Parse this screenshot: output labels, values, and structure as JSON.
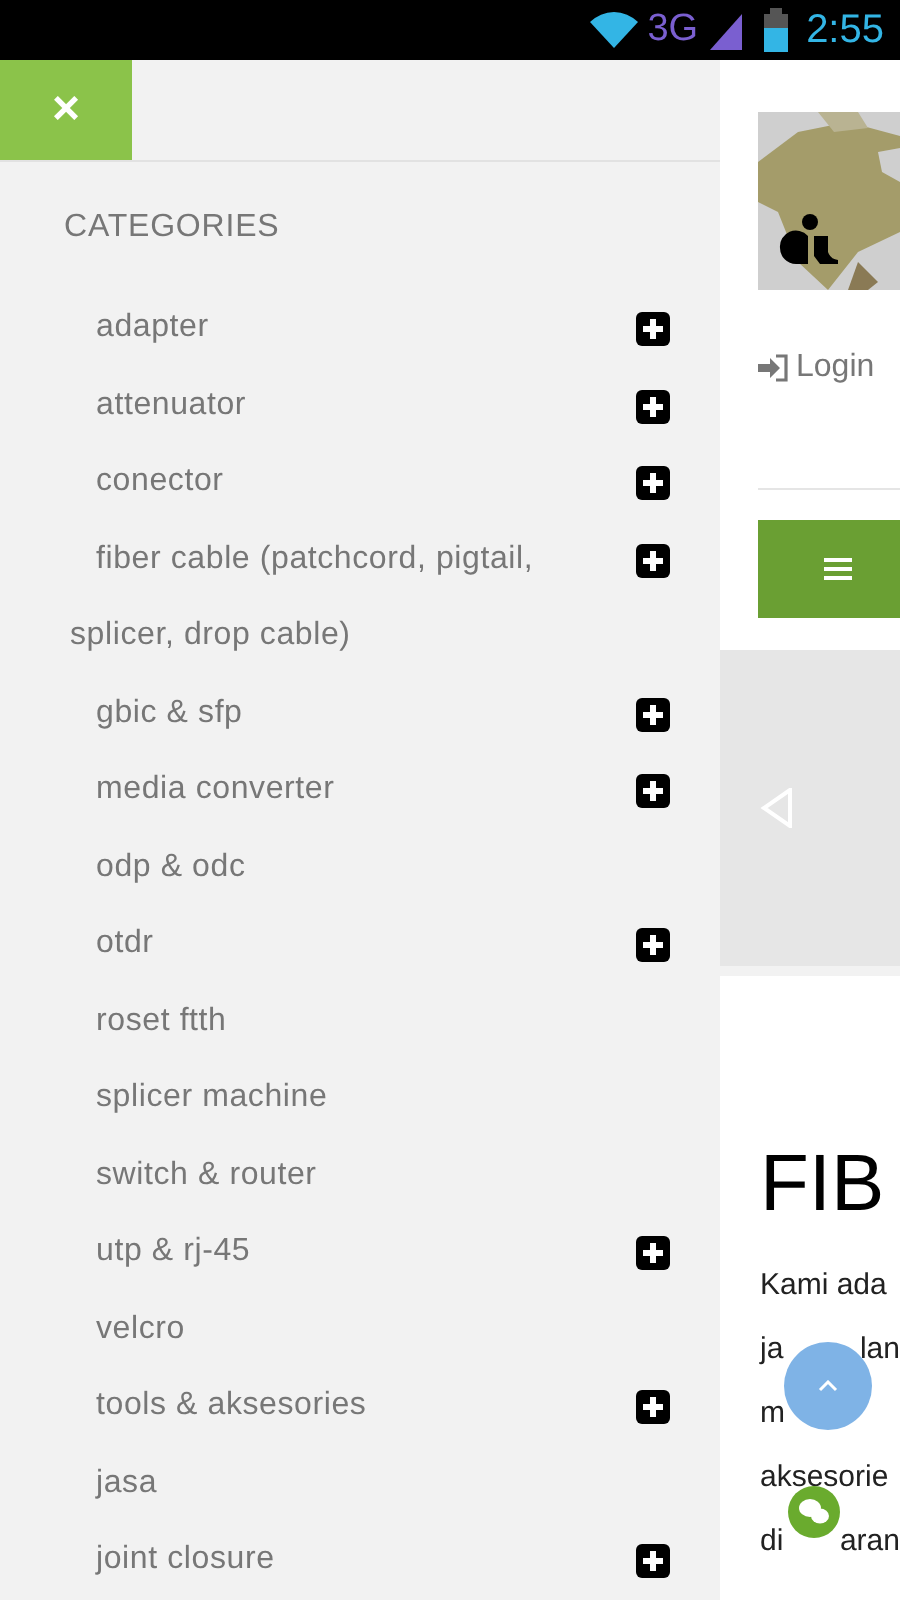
{
  "status_bar": {
    "network": "3G",
    "time": "2:55"
  },
  "drawer": {
    "close": "×",
    "heading": "CATEGORIES",
    "items": [
      {
        "label": "adapter",
        "expandable": true
      },
      {
        "label": "attenuator",
        "expandable": true
      },
      {
        "label": "conector",
        "expandable": true
      },
      {
        "label": "fiber cable (patchcord, pigtail, splicer, drop cable)",
        "expandable": true
      },
      {
        "label": "gbic & sfp",
        "expandable": true
      },
      {
        "label": "media converter",
        "expandable": true
      },
      {
        "label": "odp & odc",
        "expandable": false
      },
      {
        "label": "otdr",
        "expandable": true
      },
      {
        "label": "roset ftth",
        "expandable": false
      },
      {
        "label": "splicer machine",
        "expandable": false
      },
      {
        "label": "switch & router",
        "expandable": false
      },
      {
        "label": "utp & rj-45",
        "expandable": true
      },
      {
        "label": "velcro",
        "expandable": false
      },
      {
        "label": "tools & aksesories",
        "expandable": true
      },
      {
        "label": "jasa",
        "expandable": false
      },
      {
        "label": "joint closure",
        "expandable": true
      }
    ]
  },
  "page": {
    "login": "Login",
    "heading": "FIB",
    "lines": [
      [
        "Kami ada"
      ],
      [
        "ja",
        "lan"
      ],
      [
        "m"
      ],
      [
        "aksesorie"
      ],
      [
        "di",
        "aran"
      ]
    ]
  }
}
